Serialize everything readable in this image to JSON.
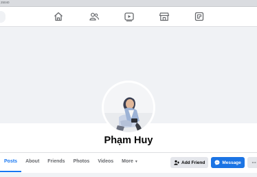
{
  "browser": {
    "url_fragment": "25040"
  },
  "topnav": {
    "items": [
      {
        "icon": "home-icon"
      },
      {
        "icon": "friends-icon"
      },
      {
        "icon": "watch-icon"
      },
      {
        "icon": "marketplace-icon"
      },
      {
        "icon": "gaming-icon"
      }
    ]
  },
  "profile": {
    "name": "Phạm Huy"
  },
  "tabs": [
    {
      "label": "Posts",
      "active": true
    },
    {
      "label": "About"
    },
    {
      "label": "Friends"
    },
    {
      "label": "Photos"
    },
    {
      "label": "Videos"
    },
    {
      "label": "More"
    }
  ],
  "actions": {
    "add_friend": "Add Friend",
    "message": "Message",
    "more": "···"
  },
  "colors": {
    "accent": "#1877f2",
    "button_blue": "#1b74e4",
    "button_grey": "#e4e6eb",
    "text_secondary": "#65676b"
  }
}
